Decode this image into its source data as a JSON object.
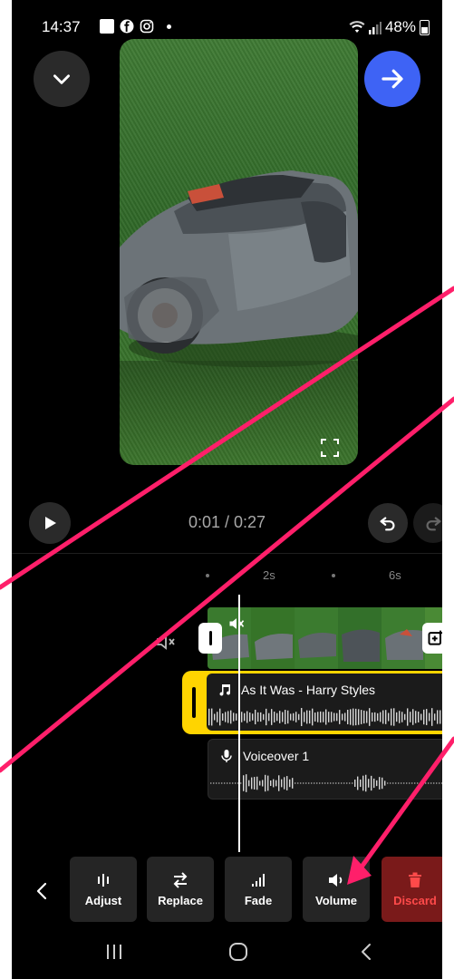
{
  "status_bar": {
    "time": "14:37",
    "battery_text": "48%",
    "icons": [
      "linkedin-icon",
      "facebook-icon",
      "instagram-icon",
      "notification-dot-icon",
      "wifi-icon",
      "signal-icon",
      "battery-icon"
    ]
  },
  "header": {
    "collapse_icon": "chevron-down-icon",
    "export_icon": "arrow-right-icon",
    "export_color": "#3e63f5"
  },
  "player": {
    "time_display": "0:01 / 0:27",
    "play_icon": "play-icon",
    "undo_icon": "undo-icon",
    "redo_icon": "redo-icon"
  },
  "timeline": {
    "ruler_labels": [
      "2s",
      "6s"
    ],
    "music_track": {
      "title": "As It Was - Harry Styles",
      "accent": "#ffd400"
    },
    "voiceover_track": {
      "title": "Voiceover 1"
    }
  },
  "toolbar": {
    "items": [
      {
        "label": "Adjust",
        "icon": "adjust-icon"
      },
      {
        "label": "Replace",
        "icon": "replace-icon"
      },
      {
        "label": "Fade",
        "icon": "fade-icon"
      },
      {
        "label": "Volume",
        "icon": "volume-icon"
      },
      {
        "label": "Discard",
        "icon": "trash-icon"
      }
    ],
    "discard_color": "#ff4a4a"
  },
  "annotation_color": "#ff1f6a"
}
